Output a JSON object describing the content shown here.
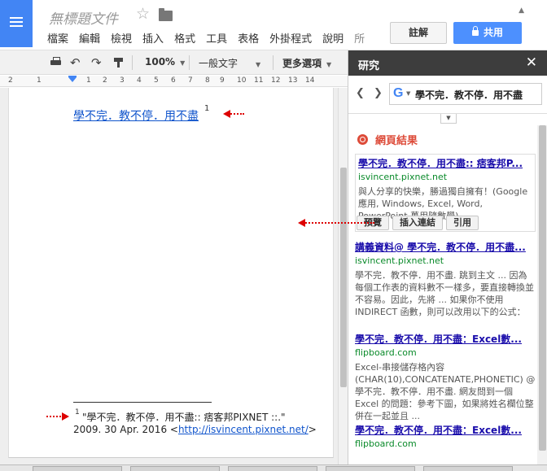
{
  "header": {
    "doc_title": "無標題文件",
    "menu": [
      "檔案",
      "編輯",
      "檢視",
      "插入",
      "格式",
      "工具",
      "表格",
      "外掛程式",
      "說明",
      "所"
    ],
    "comment_label": "註解",
    "share_label": "共用"
  },
  "toolbar": {
    "zoom": "100%",
    "style": "一般文字",
    "more": "更多選項"
  },
  "ruler": {
    "ticks": [
      "2",
      "1",
      "1",
      "2",
      "3",
      "4",
      "5",
      "6",
      "7",
      "8",
      "9",
      "10",
      "11",
      "12",
      "13",
      "14"
    ]
  },
  "document": {
    "body_link": "學不完．教不停．用不盡",
    "sup": "1",
    "footnote_sup": "1",
    "footnote_line1": "\"學不完．教不停．用不盡:: 痞客邦PIXNET ::.\"",
    "footnote_prefix": "2009. 30 Apr. 2016 <",
    "footnote_url": "http://isvincent.pixnet.net/",
    "footnote_suffix": ">"
  },
  "panel": {
    "title": "研究",
    "search_query": "學不完．教不停．用不盡",
    "web_results_label": "網頁結果",
    "results": [
      {
        "title": "學不完．教不停．用不盡:: 痞客邦P...",
        "url": "isvincent.pixnet.net",
        "snippet": "與人分享的快樂，勝過獨自擁有！(Google應用, Windows, Excel, Word, PowerPoint,萬用隨數學)"
      },
      {
        "title": "講義資料@ 學不完．教不停．用不盡...",
        "url": "isvincent.pixnet.net",
        "snippet": "學不完．教不停．用不盡. 跳到主文 ... 因為每個工作表的資料數不一樣多，要直接轉換並不容易。因此，先將 ... 如果你不使用INDIRECT 函數，則可以改用以下的公式："
      },
      {
        "title": "學不完．教不停．用不盡：Excel數...",
        "url": "flipboard.com",
        "snippet": "Excel-串接儲存格內容(CHAR(10),CONCATENATE,PHONETIC) @ 學不完．教不停．用不盡. 網友問到一個Excel 的問題：參考下圖，如果將姓名欄位整併在一起並且 ..."
      },
      {
        "title": "學不完．教不停．用不盡：Excel數...",
        "url": "flipboard.com"
      }
    ],
    "actions": [
      "預覽",
      "插入連結",
      "引用"
    ]
  }
}
